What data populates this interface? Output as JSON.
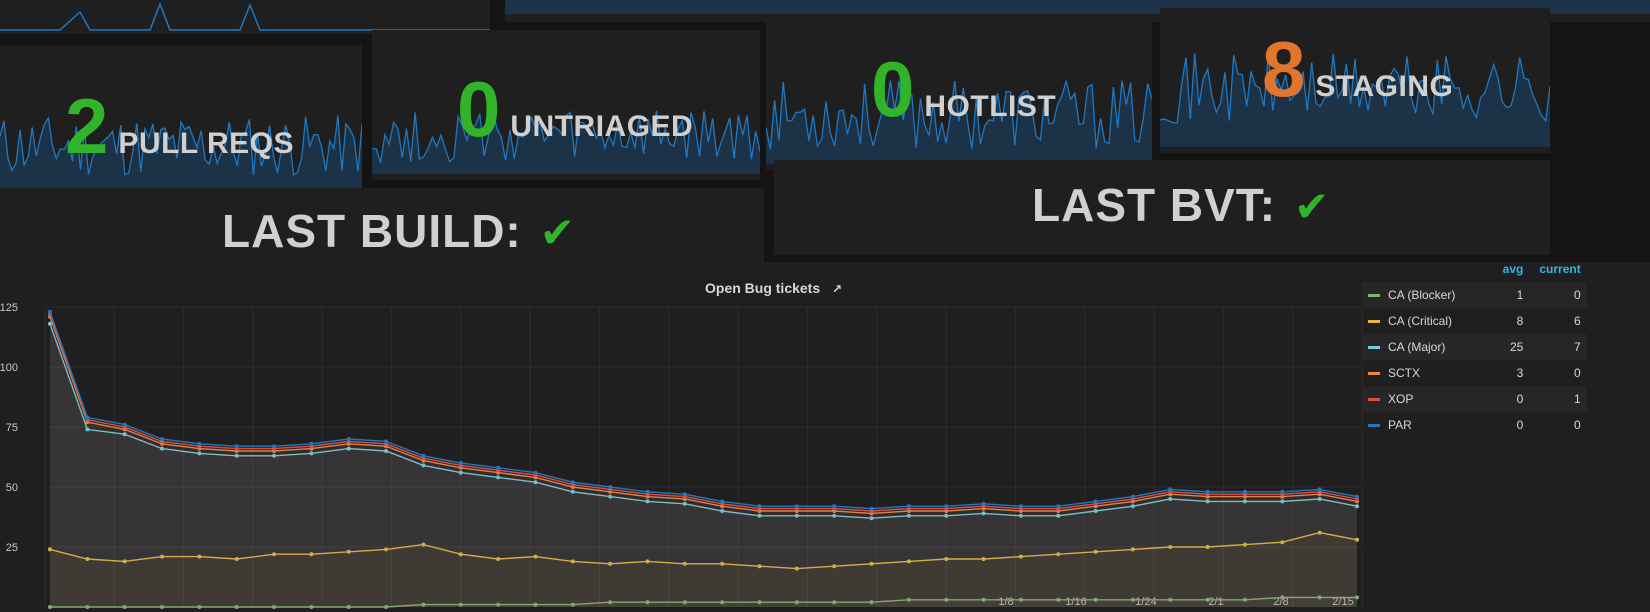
{
  "stats": [
    {
      "value": "2",
      "label": "PULL REQS",
      "color": "#31b42a"
    },
    {
      "value": "0",
      "label": "UNTRIAGED",
      "color": "#31b42a"
    },
    {
      "value": "0",
      "label": "HOTLIST",
      "color": "#31b42a"
    },
    {
      "value": "8",
      "label": "STAGING",
      "color": "#e0752d"
    }
  ],
  "status": {
    "build_label": "LAST BUILD:",
    "bvt_label": "LAST BVT:",
    "check": "✔"
  },
  "chart_data": {
    "type": "line",
    "title": "Open Bug tickets",
    "ylim": [
      0,
      125
    ],
    "yticks": [
      "25",
      "50",
      "75",
      "100",
      "125"
    ],
    "xticks": [
      "1/8",
      "1/16",
      "1/24",
      "2/1",
      "2/8",
      "2/15"
    ],
    "grid": true,
    "legend_placement": "right",
    "legend_headers": {
      "avg": "avg",
      "current": "current"
    },
    "series": [
      {
        "name": "CA (Blocker)",
        "color": "#7eb26d",
        "avg": "1",
        "current": "0",
        "values": [
          0,
          0,
          0,
          0,
          0,
          0,
          0,
          0,
          0,
          0,
          1,
          1,
          1,
          1,
          1,
          2,
          2,
          2,
          2,
          2,
          2,
          2,
          2,
          3,
          3,
          3,
          3,
          3,
          3,
          3,
          3,
          3,
          3,
          4,
          4,
          4
        ]
      },
      {
        "name": "CA (Critical)",
        "color": "#eab839",
        "avg": "8",
        "current": "6",
        "values": [
          24,
          20,
          19,
          21,
          21,
          20,
          22,
          22,
          23,
          24,
          26,
          22,
          20,
          21,
          19,
          18,
          19,
          18,
          18,
          17,
          16,
          17,
          18,
          19,
          20,
          20,
          21,
          22,
          23,
          24,
          25,
          25,
          26,
          27,
          31,
          28
        ]
      },
      {
        "name": "CA (Major)",
        "color": "#6ed0e0",
        "avg": "25",
        "current": "7",
        "values": [
          118,
          74,
          72,
          66,
          64,
          63,
          63,
          64,
          66,
          65,
          59,
          56,
          54,
          52,
          48,
          46,
          44,
          43,
          40,
          38,
          38,
          38,
          37,
          38,
          38,
          39,
          38,
          38,
          40,
          42,
          45,
          44,
          44,
          44,
          45,
          42
        ]
      },
      {
        "name": "SCTX",
        "color": "#ef843c",
        "avg": "3",
        "current": "0",
        "values": [
          121,
          77,
          74,
          68,
          66,
          65,
          65,
          66,
          68,
          67,
          61,
          58,
          56,
          54,
          50,
          48,
          46,
          45,
          42,
          40,
          40,
          40,
          39,
          40,
          40,
          41,
          40,
          40,
          42,
          44,
          47,
          46,
          46,
          46,
          47,
          44
        ]
      },
      {
        "name": "XOP",
        "color": "#e24d42",
        "avg": "0",
        "current": "1",
        "values": [
          122,
          78,
          75,
          69,
          67,
          66,
          66,
          67,
          69,
          68,
          62,
          59,
          57,
          55,
          51,
          49,
          47,
          46,
          43,
          41,
          41,
          41,
          40,
          41,
          41,
          42,
          41,
          41,
          43,
          45,
          48,
          47,
          47,
          47,
          48,
          45
        ]
      },
      {
        "name": "PAR",
        "color": "#1f78c1",
        "avg": "0",
        "current": "0",
        "values": [
          123,
          79,
          76,
          70,
          68,
          67,
          67,
          68,
          70,
          69,
          63,
          60,
          58,
          56,
          52,
          50,
          48,
          47,
          44,
          42,
          42,
          42,
          41,
          42,
          42,
          43,
          42,
          42,
          44,
          46,
          49,
          48,
          48,
          48,
          49,
          46
        ]
      }
    ]
  }
}
